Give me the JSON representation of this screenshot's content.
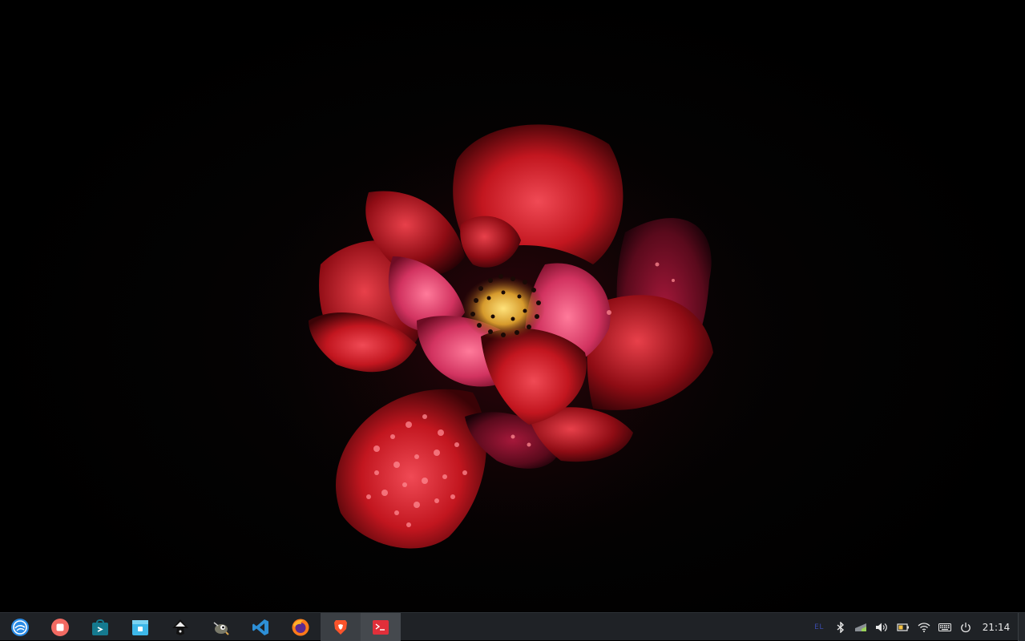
{
  "wallpaper": {
    "subject": "red-rose-on-black"
  },
  "dock": {
    "items": [
      {
        "name": "launcher",
        "icon": "deepin-launcher-icon"
      },
      {
        "name": "screen-recorder",
        "icon": "screen-recorder-icon"
      },
      {
        "name": "app-store",
        "icon": "app-store-icon"
      },
      {
        "name": "file-manager",
        "icon": "file-manager-icon"
      },
      {
        "name": "inkscape",
        "icon": "inkscape-icon"
      },
      {
        "name": "gimp",
        "icon": "gimp-icon"
      },
      {
        "name": "vscode",
        "icon": "vscode-icon"
      },
      {
        "name": "firefox",
        "icon": "firefox-icon"
      },
      {
        "name": "brave",
        "icon": "brave-icon",
        "state": "running"
      },
      {
        "name": "terminal",
        "icon": "terminal-icon",
        "state": "focused"
      }
    ]
  },
  "tray": {
    "keyboard_layout": "EL",
    "icons": [
      "bluetooth-icon",
      "network-icon",
      "volume-icon",
      "battery-icon",
      "wifi-icon",
      "onscreen-keyboard-icon",
      "power-icon"
    ]
  },
  "clock": {
    "time": "21:14"
  },
  "colors": {
    "taskbar_bg": "#1f2226",
    "active_item_bg": "#3b3f44",
    "clock_text": "#e8e8e8",
    "petal_red": "#d9262c"
  }
}
